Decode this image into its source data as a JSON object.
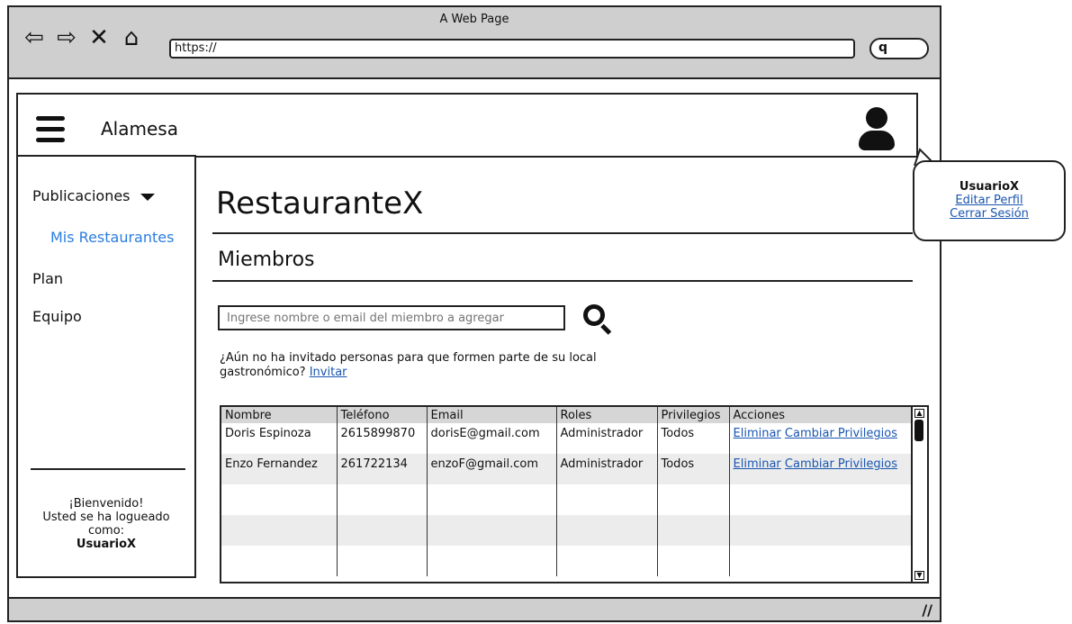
{
  "browser": {
    "title": "A Web Page",
    "url": "https://",
    "search_glyph": "q"
  },
  "appbar": {
    "brand": "Alamesa"
  },
  "sidebar": {
    "items": [
      {
        "label": "Publicaciones"
      },
      {
        "label": "Mis Restaurantes"
      },
      {
        "label": "Plan"
      },
      {
        "label": "Equipo"
      }
    ],
    "welcome_lines": [
      "¡Bienvenido!",
      "Usted se ha logueado",
      "como:"
    ],
    "welcome_user": "UsuarioX"
  },
  "main": {
    "title": "RestauranteX",
    "section": "Miembros",
    "search_placeholder": "Ingrese nombre o email del miembro a agregar",
    "invite_text": "¿Aún no ha invitado personas para que formen parte de su local gastronómico?",
    "invite_link": "Invitar"
  },
  "table": {
    "columns": [
      "Nombre",
      "Teléfono",
      "Email",
      "Roles",
      "Privilegios",
      "Acciones"
    ],
    "rows": [
      {
        "nombre": "Doris Espinoza",
        "telefono": "2615899870",
        "email": "dorisE@gmail.com",
        "rol": "Administrador",
        "privilegios": "Todos",
        "eliminar": "Eliminar",
        "cambiar": "Cambiar Privilegios"
      },
      {
        "nombre": "Enzo Fernandez",
        "telefono": "261722134",
        "email": "enzoF@gmail.com",
        "rol": "Administrador",
        "privilegios": "Todos",
        "eliminar": "Eliminar",
        "cambiar": "Cambiar Privilegios"
      }
    ]
  },
  "popover": {
    "username": "UsuarioX",
    "edit_profile": "Editar Perfil",
    "logout": "Cerrar Sesión"
  },
  "colors": {
    "link": "#1a56b0",
    "submenu": "#2a7de1",
    "chrome": "#cfcfcf"
  }
}
